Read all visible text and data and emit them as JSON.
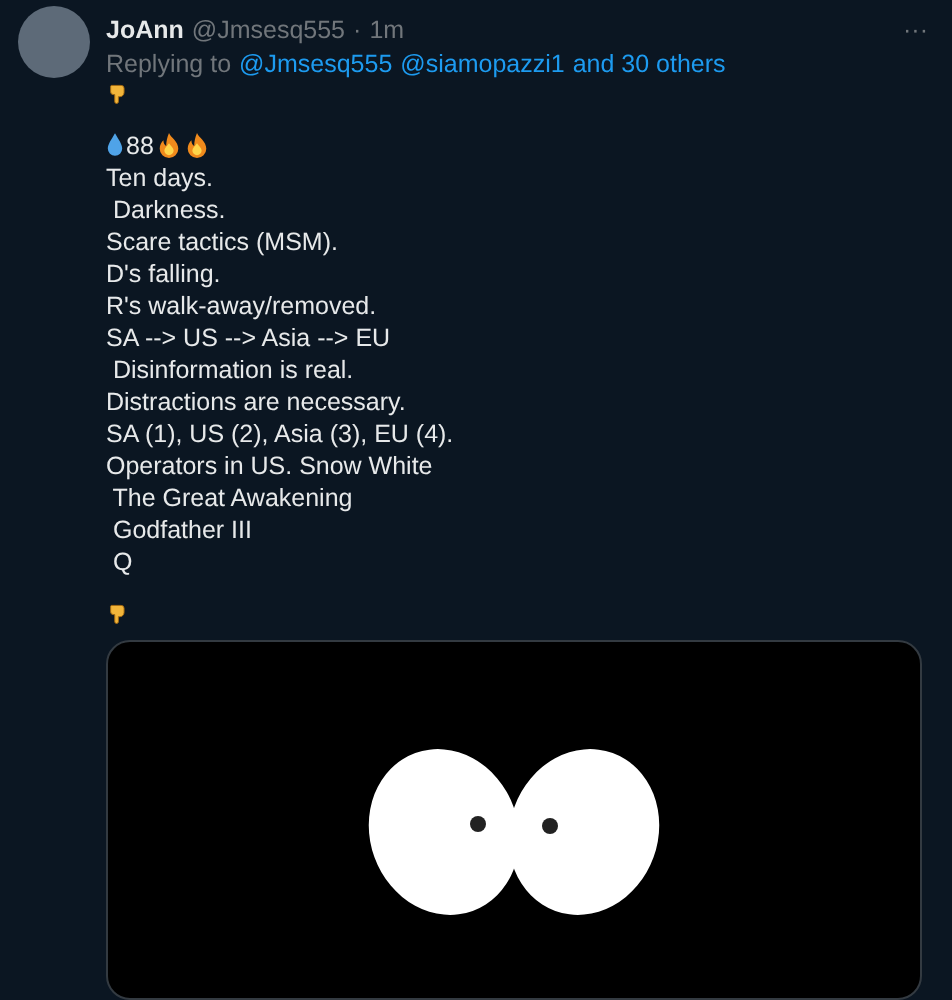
{
  "tweet": {
    "name": "JoAnn",
    "handle": "@Jmsesq555",
    "separator": "·",
    "time": "1m",
    "more": "···",
    "reply": {
      "prefix": "Replying to",
      "mentions": [
        "@Jmsesq555",
        "@siamopazzi1"
      ],
      "rest": "and 30 others"
    },
    "body": [
      {
        "kind": "pointer"
      },
      {
        "kind": "gap"
      },
      {
        "kind": "stats",
        "text": "88"
      },
      {
        "kind": "line",
        "text": "Ten days."
      },
      {
        "kind": "line",
        "text": " Darkness."
      },
      {
        "kind": "line",
        "text": "Scare tactics (MSM)."
      },
      {
        "kind": "line",
        "text": "D's falling."
      },
      {
        "kind": "line",
        "text": "R's walk-away/removed."
      },
      {
        "kind": "line",
        "text": "SA --> US --> Asia --> EU"
      },
      {
        "kind": "line",
        "text": " Disinformation is real."
      },
      {
        "kind": "line",
        "text": "Distractions are necessary."
      },
      {
        "kind": "line",
        "text": "SA (1), US (2), Asia (3), EU (4)."
      },
      {
        "kind": "line",
        "text": "Operators in US. Snow White"
      },
      {
        "kind": "line",
        "text": " The Great Awakening"
      },
      {
        "kind": "line",
        "text": " Godfather III"
      },
      {
        "kind": "line",
        "text": " Q"
      },
      {
        "kind": "gap"
      },
      {
        "kind": "pointer"
      }
    ]
  }
}
